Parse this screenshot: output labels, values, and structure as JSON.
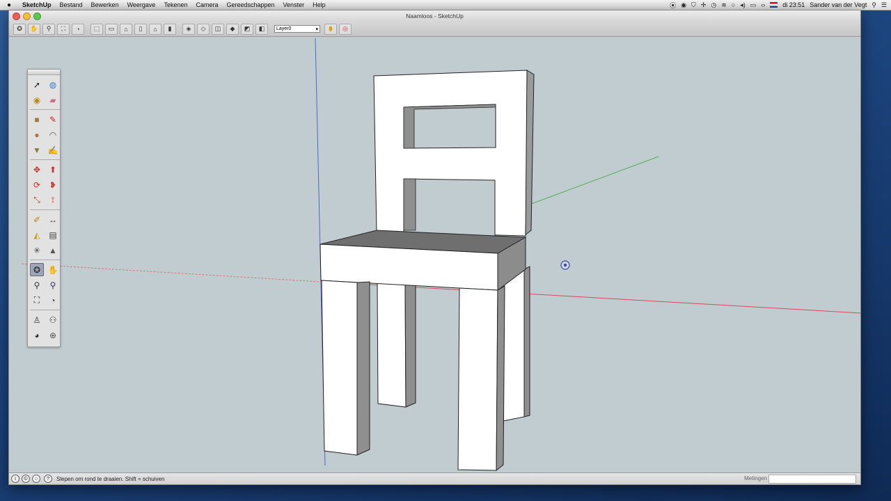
{
  "menubar": {
    "app_name": "SketchUp",
    "items": [
      "Bestand",
      "Bewerken",
      "Weergave",
      "Tekenen",
      "Camera",
      "Gereedschappen",
      "Venster",
      "Help"
    ],
    "clock": "di 23:51",
    "user": "Sander van der Vegt"
  },
  "window": {
    "title": "Naamloos - SketchUp"
  },
  "toolbar": {
    "layer_value": "Layer0"
  },
  "palette": {
    "tools": [
      {
        "name": "select-tool",
        "icon": "arrow-icon",
        "glyph": "➚",
        "color": "#222"
      },
      {
        "name": "components-tool",
        "icon": "components-icon",
        "glyph": "◍",
        "color": "#3a7ac8"
      },
      {
        "name": "paint-bucket-tool",
        "icon": "paint-bucket-icon",
        "glyph": "◉",
        "color": "#b78a1e"
      },
      {
        "name": "eraser-tool",
        "icon": "eraser-icon",
        "glyph": "▰",
        "color": "#d26a8a"
      },
      {
        "name": "rectangle-tool",
        "icon": "rectangle-icon",
        "glyph": "■",
        "color": "#a5784a"
      },
      {
        "name": "line-tool",
        "icon": "pencil-icon",
        "glyph": "✎",
        "color": "#c22"
      },
      {
        "name": "circle-tool",
        "icon": "circle-icon",
        "glyph": "●",
        "color": "#a5784a"
      },
      {
        "name": "arc-tool",
        "icon": "arc-icon",
        "glyph": "◠",
        "color": "#555"
      },
      {
        "name": "polygon-tool",
        "icon": "polygon-icon",
        "glyph": "▼",
        "color": "#8a7a4a"
      },
      {
        "name": "freehand-tool",
        "icon": "freehand-icon",
        "glyph": "✍",
        "color": "#555"
      },
      {
        "name": "move-tool",
        "icon": "move-icon",
        "glyph": "✥",
        "color": "#d22"
      },
      {
        "name": "push-pull-tool",
        "icon": "push-pull-icon",
        "glyph": "⬆",
        "color": "#c33"
      },
      {
        "name": "rotate-tool",
        "icon": "rotate-icon",
        "glyph": "⟳",
        "color": "#d22"
      },
      {
        "name": "follow-me-tool",
        "icon": "follow-me-icon",
        "glyph": "❥",
        "color": "#c44"
      },
      {
        "name": "scale-tool",
        "icon": "scale-icon",
        "glyph": "⤡",
        "color": "#c33"
      },
      {
        "name": "offset-tool",
        "icon": "offset-icon",
        "glyph": "⟟",
        "color": "#c33"
      },
      {
        "name": "tape-measure-tool",
        "icon": "tape-measure-icon",
        "glyph": "✐",
        "color": "#b8860b"
      },
      {
        "name": "dimension-tool",
        "icon": "dimension-icon",
        "glyph": "↔",
        "color": "#444"
      },
      {
        "name": "protractor-tool",
        "icon": "protractor-icon",
        "glyph": "◭",
        "color": "#c9a227"
      },
      {
        "name": "text-tool",
        "icon": "text-icon",
        "glyph": "▤",
        "color": "#444"
      },
      {
        "name": "axes-tool",
        "icon": "axes-icon",
        "glyph": "✳",
        "color": "#444"
      },
      {
        "name": "3d-text-tool",
        "icon": "3d-text-icon",
        "glyph": "▲",
        "color": "#555"
      },
      {
        "name": "orbit-tool",
        "icon": "orbit-icon",
        "glyph": "✪",
        "color": "#333",
        "active": true
      },
      {
        "name": "pan-tool",
        "icon": "pan-icon",
        "glyph": "✋",
        "color": "#555"
      },
      {
        "name": "zoom-tool",
        "icon": "zoom-icon",
        "glyph": "⚲",
        "color": "#333"
      },
      {
        "name": "zoom-window-tool",
        "icon": "zoom-window-icon",
        "glyph": "⚲",
        "color": "#335"
      },
      {
        "name": "zoom-extents-tool",
        "icon": "zoom-extents-icon",
        "glyph": "⛶",
        "color": "#333"
      },
      {
        "name": "previous-view-tool",
        "icon": "previous-view-icon",
        "glyph": "◔",
        "color": "#335"
      },
      {
        "name": "position-camera-tool",
        "icon": "position-camera-icon",
        "glyph": "♙",
        "color": "#333"
      },
      {
        "name": "walk-tool",
        "icon": "walk-icon",
        "glyph": "⚇",
        "color": "#333"
      },
      {
        "name": "look-around-tool",
        "icon": "look-around-icon",
        "glyph": "◕",
        "color": "#333"
      },
      {
        "name": "section-plane-tool",
        "icon": "section-plane-icon",
        "glyph": "⊕",
        "color": "#555"
      }
    ]
  },
  "statusbar": {
    "hint": "Slepen om rond te draaien. Shift = schuiven",
    "measurements_label": "Metingen",
    "measurements_value": ""
  },
  "colors": {
    "viewport_bg": "#c1ccd0",
    "red_axis": "#d04040",
    "green_axis": "#40b040",
    "blue_axis": "#4060c0"
  }
}
